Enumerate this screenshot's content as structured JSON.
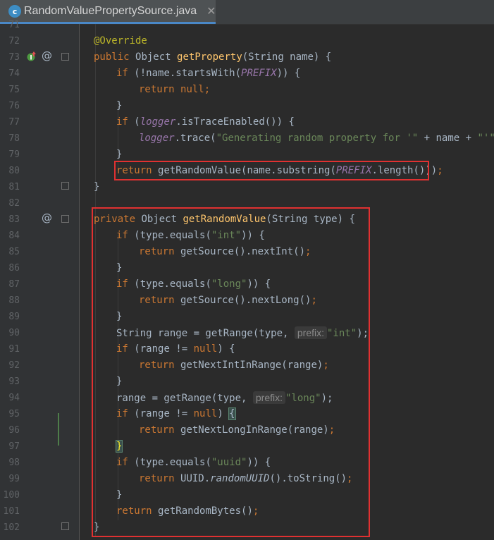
{
  "tab": {
    "title": "RandomValuePropertySource.java",
    "close": "✕",
    "icon": "java-class-icon"
  },
  "gutter": {
    "line_numbers": [
      "71",
      "72",
      "73",
      "74",
      "75",
      "76",
      "77",
      "78",
      "79",
      "80",
      "81",
      "82",
      "83",
      "84",
      "85",
      "86",
      "87",
      "88",
      "89",
      "90",
      "91",
      "92",
      "93",
      "94",
      "95",
      "96",
      "97",
      "98",
      "99",
      "100",
      "101",
      "102"
    ],
    "override_icon": "override-up-arrow-icon",
    "annotation_glyph": "@"
  },
  "code": {
    "l72": "@Override",
    "l73_kw": "public ",
    "l73_t": "Object ",
    "l73_fn": "getProperty",
    "l73_rest": "(String name) {",
    "l74_kw": "if ",
    "l74_a": "(!name.startsWith(",
    "l74_c": "PREFIX",
    "l74_b": ")) {",
    "l75_kw": "return ",
    "l75_b": "null",
    "l75_c": ";",
    "l76": "}",
    "l77_kw": "if ",
    "l77_a": "(",
    "l77_c": "logger",
    "l77_b": ".isTraceEnabled()) {",
    "l78_c": "logger",
    "l78_a": ".trace(",
    "l78_s1": "\"Generating random property for '\"",
    "l78_b": " + name + ",
    "l78_s2": "\"'\"",
    "l78_e": ");",
    "l79": "}",
    "l80_kw": "return ",
    "l80_a": "getRandomValue(name.substring(",
    "l80_c": "PREFIX",
    "l80_b": ".length()))",
    "l80_e": ";",
    "l81": "}",
    "l83_kw": "private ",
    "l83_t": "Object ",
    "l83_fn": "getRandomValue",
    "l83_rest": "(String type) {",
    "l84_kw": "if ",
    "l84_a": "(type.equals(",
    "l84_s": "\"int\"",
    "l84_b": ")) {",
    "l85_kw": "return ",
    "l85_a": "getSource().nextInt()",
    "l85_e": ";",
    "l86": "}",
    "l87_kw": "if ",
    "l87_a": "(type.equals(",
    "l87_s": "\"long\"",
    "l87_b": ")) {",
    "l88_kw": "return ",
    "l88_a": "getSource().nextLong()",
    "l88_e": ";",
    "l89": "}",
    "l90_a": "String range = getRange(type, ",
    "l90_hint": "prefix:",
    "l90_s": "\"int\"",
    "l90_e": ");",
    "l91_kw": "if ",
    "l91_a": "(range != ",
    "l91_n": "null",
    "l91_b": ") {",
    "l92_kw": "return ",
    "l92_a": "getNextIntInRange(range)",
    "l92_e": ";",
    "l93": "}",
    "l94_a": "range = getRange(type, ",
    "l94_hint": "prefix:",
    "l94_s": "\"long\"",
    "l94_e": ");",
    "l95_kw": "if ",
    "l95_a": "(range != ",
    "l95_n": "null",
    "l95_b": ") ",
    "l95_brace": "{",
    "l96_kw": "return ",
    "l96_a": "getNextLongInRange(range)",
    "l96_e": ";",
    "l97": "}",
    "l98_kw": "if ",
    "l98_a": "(type.equals(",
    "l98_s": "\"uuid\"",
    "l98_b": ")) {",
    "l99_kw": "return ",
    "l99_a": "UUID.",
    "l99_st": "randomUUID",
    "l99_b": "().toString()",
    "l99_e": ";",
    "l100": "}",
    "l101_kw": "return ",
    "l101_a": "getRandomBytes()",
    "l101_e": ";",
    "l102": "}"
  },
  "colors": {
    "background": "#2b2b2b",
    "gutter": "#313335",
    "keyword": "#cc7832",
    "function": "#ffc66d",
    "string": "#6a8759",
    "constant": "#9876aa",
    "annotation": "#bbb529",
    "highlight_box": "#e03131"
  }
}
